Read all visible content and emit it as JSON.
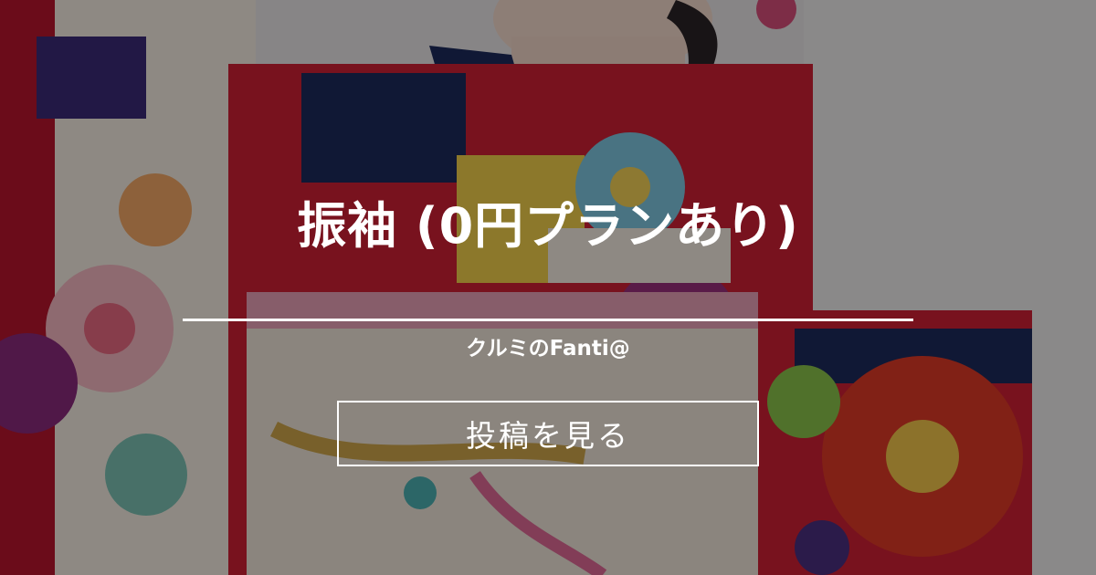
{
  "card": {
    "title": "振袖 (0円プランあり)",
    "author": "クルミのFanti@",
    "button_label": "投稿を見る"
  },
  "background": {
    "description_icon": "kimono-photo",
    "overlay_color": "#000000"
  }
}
